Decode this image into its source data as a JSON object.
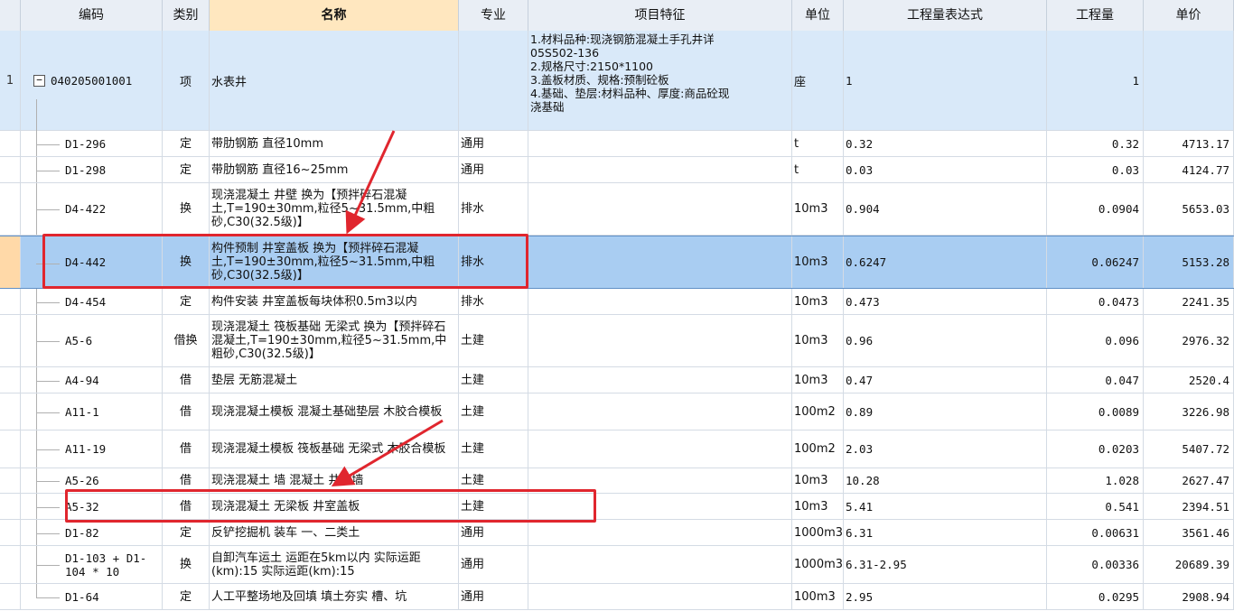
{
  "headers": {
    "code": "编码",
    "type": "类别",
    "name": "名称",
    "spec": "专业",
    "feature": "项目特征",
    "unit": "单位",
    "expr": "工程量表达式",
    "qty": "工程量",
    "price": "单价"
  },
  "main_row": {
    "num": "1",
    "toggle": "−",
    "code": "040205001001",
    "type": "项",
    "name": "水表井",
    "spec": "",
    "feature_lines": [
      "1.材料品种:现浇钢筋混凝土手孔井详",
      "05S502-136",
      "2.规格尺寸:2150*1100",
      "3.盖板材质、规格:预制砼板",
      "4.基础、垫层:材料品种、厚度:商品砼现",
      "浇基础"
    ],
    "unit": "座",
    "expr": "1",
    "qty": "1",
    "price": ""
  },
  "rows": [
    {
      "code": "D1-296",
      "type": "定",
      "name": "带肋钢筋 直径10mm",
      "spec": "通用",
      "unit": "t",
      "expr": "0.32",
      "qty": "0.32",
      "price": "4713.17"
    },
    {
      "code": "D1-298",
      "type": "定",
      "name": "带肋钢筋 直径16~25mm",
      "spec": "通用",
      "unit": "t",
      "expr": "0.03",
      "qty": "0.03",
      "price": "4124.77"
    },
    {
      "code": "D4-422",
      "type": "换",
      "name": "现浇混凝土 井壁  换为【预拌碎石混凝土,T=190±30mm,粒径5~31.5mm,中粗砂,C30(32.5级)】",
      "spec": "排水",
      "unit": "10m3",
      "expr": "0.904",
      "qty": "0.0904",
      "price": "5653.03"
    },
    {
      "code": "D4-442",
      "type": "换",
      "name": "构件预制 井室盖板  换为【预拌碎石混凝土,T=190±30mm,粒径5~31.5mm,中粗砂,C30(32.5级)】",
      "spec": "排水",
      "unit": "10m3",
      "expr": "0.6247",
      "qty": "0.06247",
      "price": "5153.28"
    },
    {
      "code": "D4-454",
      "type": "定",
      "name": "构件安装 井室盖板每块体积0.5m3以内",
      "spec": "排水",
      "unit": "10m3",
      "expr": "0.473",
      "qty": "0.0473",
      "price": "2241.35"
    },
    {
      "code": "A5-6",
      "type": "借换",
      "name": "现浇混凝土 筏板基础 无梁式  换为【预拌碎石混凝土,T=190±30mm,粒径5~31.5mm,中粗砂,C30(32.5级)】",
      "spec": "土建",
      "unit": "10m3",
      "expr": "0.96",
      "qty": "0.096",
      "price": "2976.32"
    },
    {
      "code": "A4-94",
      "type": "借",
      "name": "垫层 无筋混凝土",
      "spec": "土建",
      "unit": "10m3",
      "expr": "0.47",
      "qty": "0.047",
      "price": "2520.4"
    },
    {
      "code": "A11-1",
      "type": "借",
      "name": "现浇混凝土模板 混凝土基础垫层 木胶合模板",
      "spec": "土建",
      "unit": "100m2",
      "expr": "0.89",
      "qty": "0.0089",
      "price": "3226.98"
    },
    {
      "code": "A11-19",
      "type": "借",
      "name": "现浇混凝土模板 筏板基础 无梁式 木胶合模板",
      "spec": "土建",
      "unit": "100m2",
      "expr": "2.03",
      "qty": "0.0203",
      "price": "5407.72"
    },
    {
      "code": "A5-26",
      "type": "借",
      "name": "现浇混凝土 墙 混凝土 井壁墙",
      "spec": "土建",
      "unit": "10m3",
      "expr": "10.28",
      "qty": "1.028",
      "price": "2627.47"
    },
    {
      "code": "A5-32",
      "type": "借",
      "name": "现浇混凝土 无梁板 井室盖板",
      "spec": "土建",
      "unit": "10m3",
      "expr": "5.41",
      "qty": "0.541",
      "price": "2394.51"
    },
    {
      "code": "D1-82",
      "type": "定",
      "name": "反铲挖掘机 装车 一、二类土",
      "spec": "通用",
      "unit": "1000m3",
      "expr": "6.31",
      "qty": "0.00631",
      "price": "3561.46"
    },
    {
      "code": "D1-103 + D1-104 * 10",
      "type": "换",
      "name": "自卸汽车运土 运距在5km以内  实际运距(km):15  实际运距(km):15",
      "spec": "通用",
      "unit": "1000m3",
      "expr": "6.31-2.95",
      "qty": "0.00336",
      "price": "20689.39"
    },
    {
      "code": "D1-64",
      "type": "定",
      "name": "人工平整场地及回填 填土夯实 槽、坑",
      "spec": "通用",
      "unit": "100m3",
      "expr": "2.95",
      "qty": "0.0295",
      "price": "2908.94"
    }
  ],
  "colors": {
    "header_bg": "#e9eef5",
    "header_highlight": "#ffe7bf",
    "main_row_bg": "#d9e9f9",
    "selected_row_bg": "#a9cdf2",
    "annotation_red": "#e0262e"
  }
}
